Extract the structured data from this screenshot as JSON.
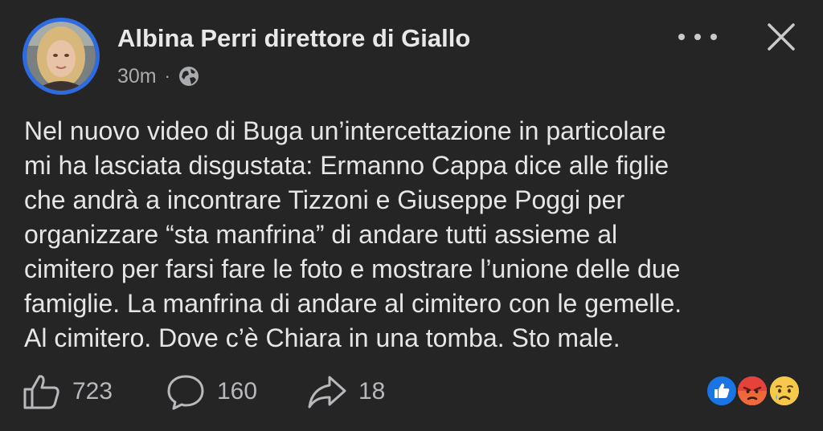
{
  "post": {
    "author_name": "Albina Perri direttore di Giallo",
    "time": "30m",
    "separator": "·",
    "audience_icon": "globe-icon",
    "text_lines": [
      "Nel nuovo video di Buga un’intercettazione in particolare",
      "mi ha lasciata disgustata: Ermanno Cappa dice alle figlie",
      "che andrà a  incontrare Tizzoni e Giuseppe Poggi per",
      "organizzare “sta manfrina” di andare tutti assieme al",
      "cimitero per farsi fare le foto e mostrare l’unione delle due",
      "famiglie. La manfrina di andare al cimitero con le gemelle.",
      "Al cimitero. Dove c’è Chiara in una tomba. Sto male."
    ]
  },
  "header_controls": {
    "more_icon": "more-dots-icon",
    "close_icon": "close-icon"
  },
  "actions": {
    "like_count": "723",
    "comment_count": "160",
    "share_count": "18"
  },
  "reactions": [
    "like-reaction-icon",
    "angry-reaction-icon",
    "sad-reaction-icon"
  ],
  "colors": {
    "background": "#252526",
    "avatar_ring": "#2d6be0",
    "like_blue": "#1b74e4",
    "angry_orange": "#f0693b",
    "sad_yellow": "#f7c94a"
  }
}
